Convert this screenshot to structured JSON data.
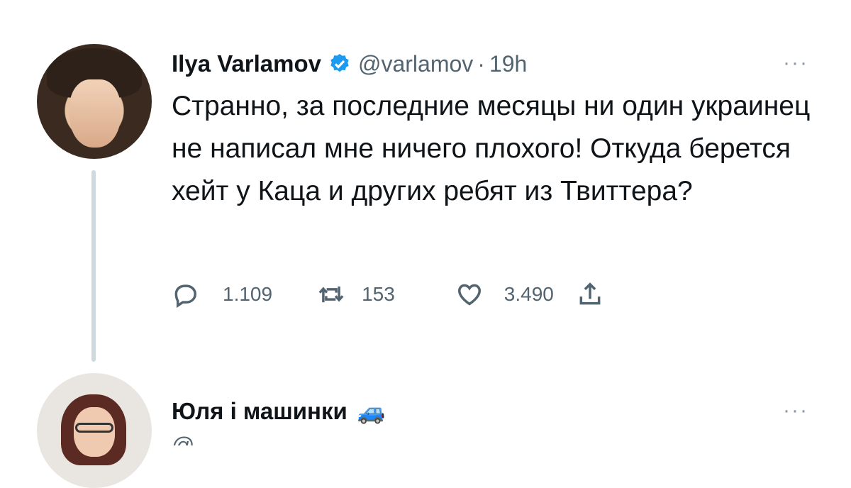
{
  "tweet": {
    "author_name": "Ilya Varlamov",
    "handle": "@varlamov",
    "separator": "·",
    "time": "19h",
    "more": "···",
    "text": "Странно, за последние месяцы ни один украинец не написал мне ничего плохого! Откуда берется хейт у Каца и других ребят из Твиттера?",
    "replies": "1.109",
    "retweets": "153",
    "likes": "3.490"
  },
  "reply": {
    "author_name": "Юля і машинки",
    "emoji": "🚙",
    "more": "···",
    "handle_partial": "@..."
  },
  "icons": {
    "verified": "verified-badge-icon",
    "reply": "reply-icon",
    "retweet": "retweet-icon",
    "like": "heart-icon",
    "share": "share-icon"
  },
  "colors": {
    "verified": "#1d9bf0",
    "secondary_text": "#536471",
    "thread_line": "#cfd9de"
  }
}
